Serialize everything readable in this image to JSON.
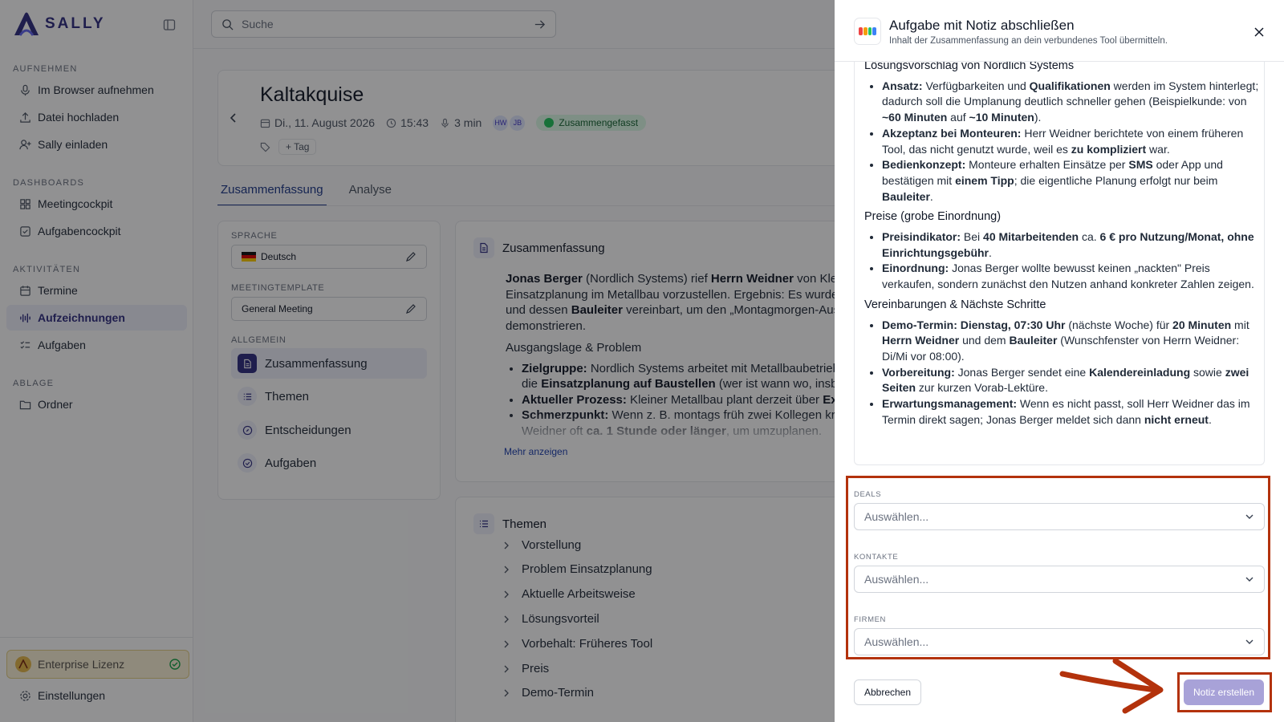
{
  "app": {
    "name": "SALLY"
  },
  "search": {
    "placeholder": "Suche"
  },
  "sidebar": {
    "sections": [
      {
        "label": "AUFNEHMEN",
        "items": [
          "Im Browser aufnehmen",
          "Datei hochladen",
          "Sally einladen"
        ]
      },
      {
        "label": "DASHBOARDS",
        "items": [
          "Meetingcockpit",
          "Aufgabencockpit"
        ]
      },
      {
        "label": "AKTIVITÄTEN",
        "items": [
          "Termine",
          "Aufzeichnungen",
          "Aufgaben"
        ]
      },
      {
        "label": "ABLAGE",
        "items": [
          "Ordner"
        ]
      }
    ],
    "active_item": "Aufzeichnungen",
    "license": "Enterprise Lizenz",
    "settings": "Einstellungen"
  },
  "meeting": {
    "title": "Kaltakquise",
    "date": "Di., 11. August 2026",
    "time": "15:43",
    "duration": "3 min",
    "participants": [
      "HW",
      "JB"
    ],
    "status": "Zusammengefasst",
    "tag_button": "Tag"
  },
  "tabs": [
    "Zusammenfassung",
    "Analyse"
  ],
  "settings_panel": {
    "language_label": "SPRACHE",
    "language_value": "Deutsch",
    "template_label": "MEETINGTEMPLATE",
    "template_value": "General Meeting",
    "general_label": "ALLGEMEIN",
    "items": [
      "Zusammenfassung",
      "Themen",
      "Entscheidungen",
      "Aufgaben"
    ]
  },
  "summary": {
    "title": "Zusammenfassung",
    "more_link": "Mehr anzeigen"
  },
  "topics": {
    "title": "Themen",
    "items": [
      "Vorstellung",
      "Problem Einsatzplanung",
      "Aktuelle Arbeitsweise",
      "Lösungsvorteil",
      "Vorbehalt: Früheres Tool",
      "Preis",
      "Demo-Termin"
    ]
  },
  "dialog": {
    "title": "Aufgabe mit Notiz abschließen",
    "subtitle": "Inhalt der Zusammenfassung an dein verbundenes Tool übermitteln.",
    "fields": [
      {
        "label": "DEALS",
        "placeholder": "Auswählen..."
      },
      {
        "label": "KONTAKTE",
        "placeholder": "Auswählen..."
      },
      {
        "label": "FIRMEN",
        "placeholder": "Auswählen..."
      }
    ],
    "cancel": "Abbrechen",
    "submit": "Notiz erstellen"
  },
  "colors": {
    "accent": "#312e81",
    "annotation": "#b3320c",
    "submit_disabled": "#a8a2d8"
  }
}
